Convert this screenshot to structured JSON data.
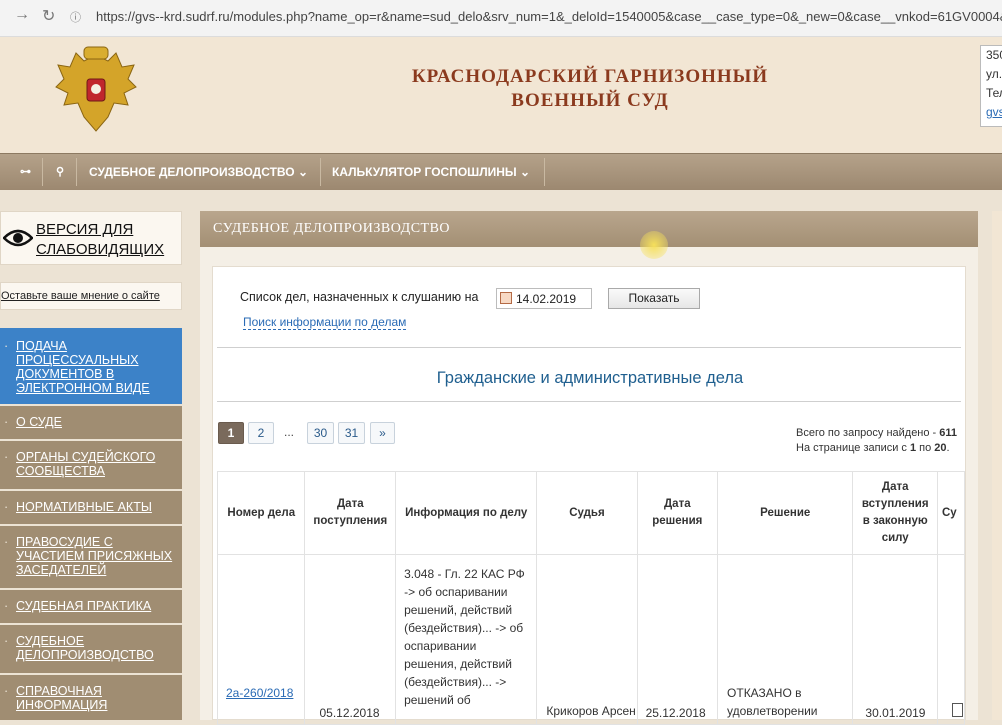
{
  "browser": {
    "url": "https://gvs--krd.sudrf.ru/modules.php?name_op=r&name=sud_delo&srv_num=1&_deloId=1540005&case__case_type=0&_new=0&case__vnkod=61GV0004&case__num_"
  },
  "header": {
    "title_line1": "КРАСНОДАРСКИЙ ГАРНИЗОННЫЙ",
    "title_line2": "ВОЕННЫЙ СУД",
    "contact_line1": "350",
    "contact_line2": "ул.",
    "contact_line3": "Тел",
    "contact_link": "gvs"
  },
  "nav": {
    "item1": "СУДЕБНОЕ ДЕЛОПРОИЗВОДСТВО",
    "item2": "КАЛЬКУЛЯТОР ГОСПОШЛИНЫ"
  },
  "sidebar": {
    "vision_line1": "ВЕРСИЯ ДЛЯ",
    "vision_line2": "СЛАБОВИДЯЩИХ",
    "feedback": "Оставьте ваше мнение о сайте",
    "items": [
      {
        "label": "ПОДАЧА ПРОЦЕССУАЛЬНЫХ ДОКУМЕНТОВ В ЭЛЕКТРОННОМ ВИДЕ"
      },
      {
        "label": "О СУДЕ"
      },
      {
        "label": "ОРГАНЫ СУДЕЙСКОГО СООБЩЕСТВА"
      },
      {
        "label": "НОРМАТИВНЫЕ АКТЫ"
      },
      {
        "label": "ПРАВОСУДИЕ С УЧАСТИЕМ ПРИСЯЖНЫХ ЗАСЕДАТЕЛЕЙ"
      },
      {
        "label": "СУДЕБНАЯ ПРАКТИКА"
      },
      {
        "label": "СУДЕБНОЕ ДЕЛОПРОИЗВОДСТВО"
      },
      {
        "label": "СПРАВОЧНАЯ ИНФОРМАЦИЯ"
      }
    ]
  },
  "main": {
    "header": "СУДЕБНОЕ ДЕЛОПРОИЗВОДСТВО",
    "list_label": "Список дел, назначенных к слушанию на",
    "date_value": "14.02.2019",
    "show_button": "Показать",
    "search_link": "Поиск информации по делам",
    "section_title": "Гражданские и административные дела",
    "pagination": [
      "1",
      "2",
      "...",
      "30",
      "31",
      "»"
    ],
    "total_prefix": "Всего по запросу найдено - ",
    "total_count": "611",
    "per_page_prefix": "На странице записи с ",
    "per_page_from": "1",
    "per_page_mid": " по ",
    "per_page_to": "20",
    "table": {
      "headers": [
        "Номер дела",
        "Дата поступления",
        "Информация по делу",
        "Судья",
        "Дата решения",
        "Решение",
        "Дата вступления в законную силу",
        "Су"
      ],
      "row1": {
        "case_number": "2а-260/2018",
        "received": "05.12.2018",
        "info": "3.048 - Гл. 22 КАС РФ -> об оспаривании решений, действий (бездействия)... -> об оспаривании решения, действий (бездействия)... -> решений об",
        "judge": "Крикоров Арсен",
        "decision_date": "25.12.2018",
        "decision": "ОТКАЗАНО в удовлетворении",
        "effective": "30.01.2019"
      }
    }
  }
}
